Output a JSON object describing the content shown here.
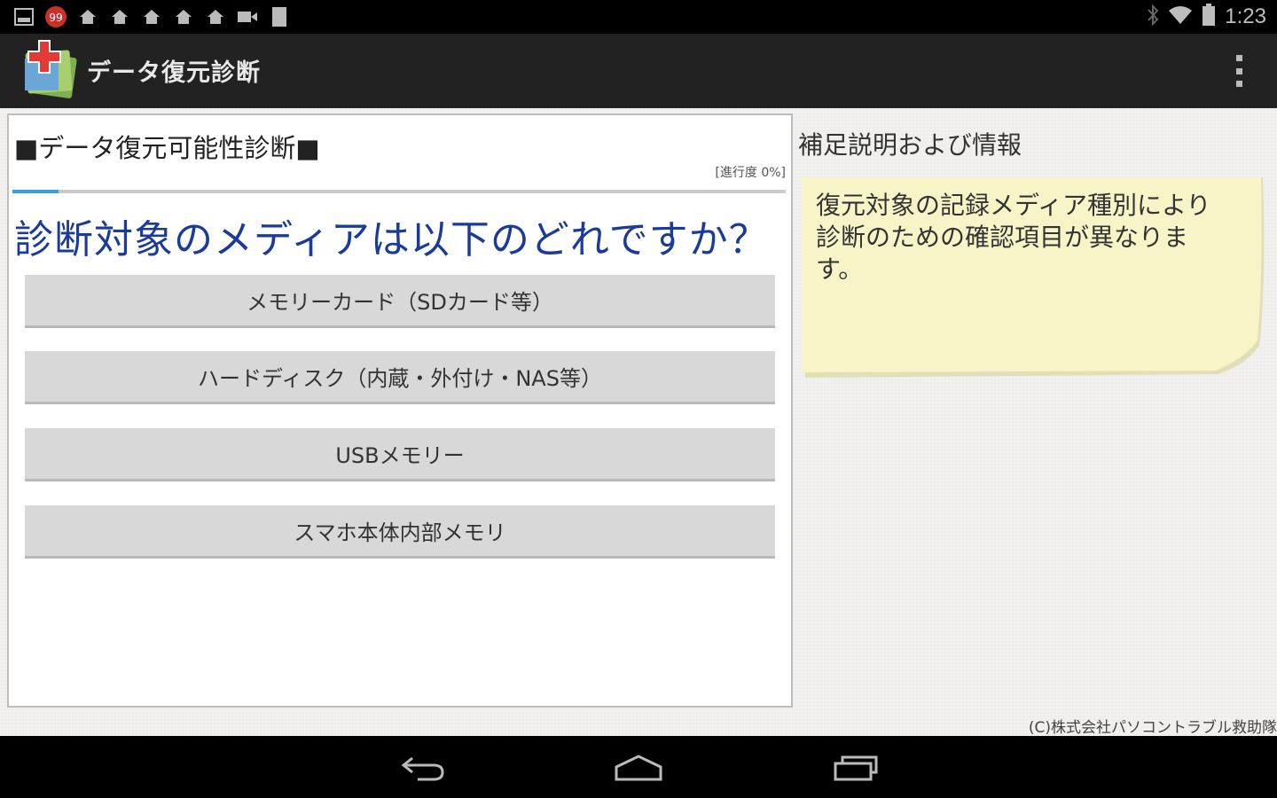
{
  "status_bar": {
    "time": "1:23",
    "notification_badge": "99",
    "left_icons": [
      "image-icon",
      "mail-badge-icon",
      "house-icon",
      "house-icon",
      "house-icon",
      "house-icon",
      "house-icon",
      "video-icon",
      "battery-full-icon"
    ],
    "right_icons": [
      "bluetooth-icon",
      "wifi-icon",
      "battery-icon"
    ]
  },
  "action_bar": {
    "title": "データ復元診断"
  },
  "left_panel": {
    "section_title": "■データ復元可能性診断■",
    "progress_label": "[進行度 0%]",
    "progress_fraction": 0.06,
    "question": "診断対象のメディアは以下のどれですか？",
    "choices": [
      {
        "label": "メモリーカード（SDカード等）"
      },
      {
        "label": "ハードディスク（内蔵・外付け・NAS等）"
      },
      {
        "label": "USBメモリー"
      },
      {
        "label": "スマホ本体内部メモリ"
      }
    ]
  },
  "right_panel": {
    "title": "補足説明および情報",
    "note_text": "復元対象の記録メディア種別により診断のための確認項目が異なります。",
    "note_color": "#f7f4c7"
  },
  "footer": {
    "copyright": "(C)株式会社パソコントラブル救助隊"
  },
  "nav_bar": {
    "buttons": [
      "back-icon",
      "home-icon",
      "recent-apps-icon"
    ]
  },
  "colors": {
    "question_text": "#1a3a9c",
    "action_bar": "#222222",
    "button_bg": "#d8d8d8"
  }
}
